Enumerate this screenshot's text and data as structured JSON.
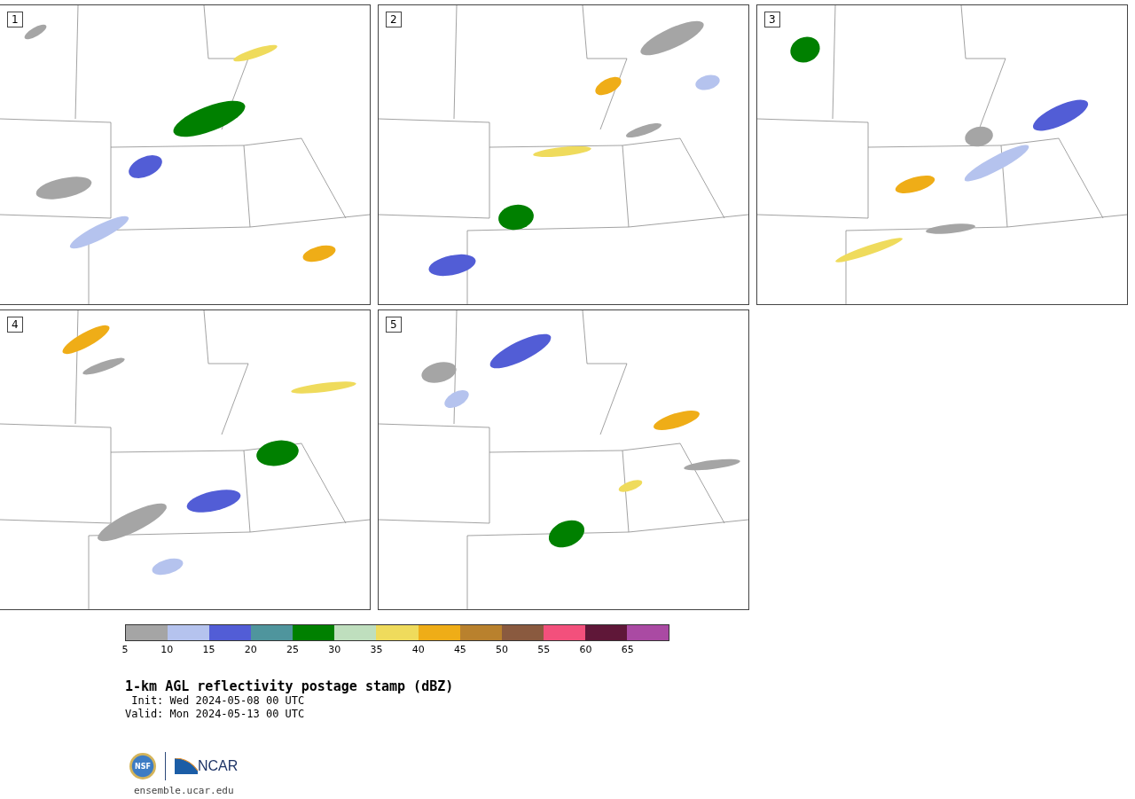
{
  "panels": [
    {
      "label": "1"
    },
    {
      "label": "2"
    },
    {
      "label": "3"
    },
    {
      "label": "4"
    },
    {
      "label": "5"
    }
  ],
  "colorbar": {
    "bins": [
      {
        "color": "#a5a5a5"
      },
      {
        "color": "#b5c3ee"
      },
      {
        "color": "#525dd6"
      },
      {
        "color": "#4f959d"
      },
      {
        "color": "#008000"
      },
      {
        "color": "#bfdfbe"
      },
      {
        "color": "#efdb5c"
      },
      {
        "color": "#efad17"
      },
      {
        "color": "#b9812d"
      },
      {
        "color": "#8a5a3f"
      },
      {
        "color": "#f3507c"
      },
      {
        "color": "#5f1738"
      },
      {
        "color": "#aa4aa3"
      }
    ],
    "tick_labels": [
      "5",
      "10",
      "15",
      "20",
      "25",
      "30",
      "35",
      "40",
      "45",
      "50",
      "55",
      "60",
      "65"
    ]
  },
  "title": "1-km AGL reflectivity postage stamp (dBZ)",
  "init": " Init: Wed 2024-05-08 00 UTC",
  "valid": "Valid: Mon 2024-05-13 00 UTC",
  "logos": {
    "nsf": "NSF",
    "ncar": "NCAR"
  },
  "url": "ensemble.ucar.edu"
}
